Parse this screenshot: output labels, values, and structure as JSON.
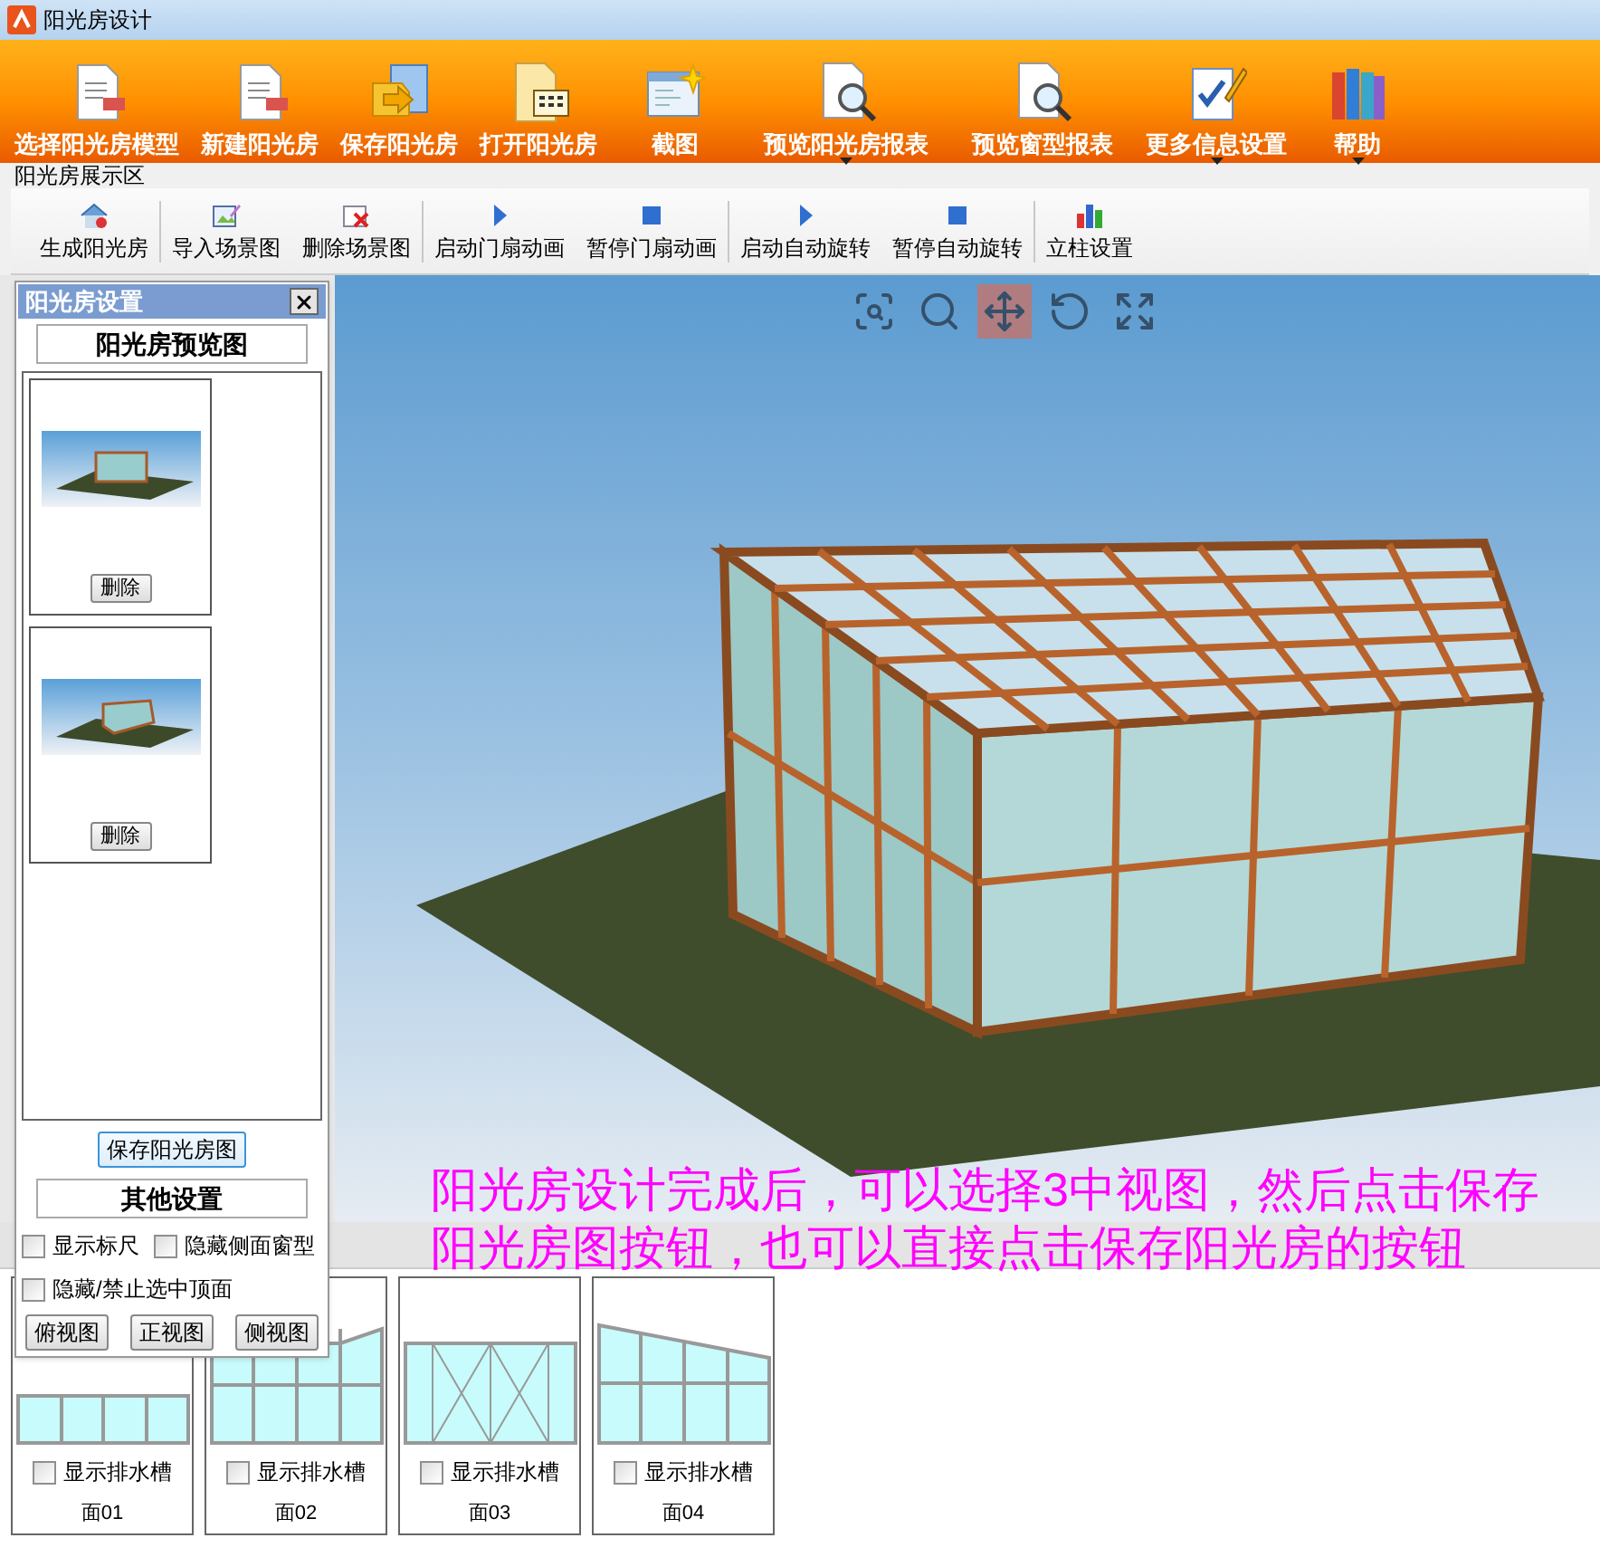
{
  "window": {
    "title": "阳光房设计"
  },
  "ribbon": [
    {
      "label": "选择阳光房模型",
      "kind": "document",
      "dropdown": false
    },
    {
      "label": "新建阳光房",
      "kind": "document",
      "dropdown": false
    },
    {
      "label": "保存阳光房",
      "kind": "save",
      "dropdown": false
    },
    {
      "label": "打开阳光房",
      "kind": "open",
      "dropdown": false
    },
    {
      "label": "截图",
      "kind": "capture",
      "dropdown": false
    },
    {
      "label": "预览阳光房报表",
      "kind": "report",
      "dropdown": true
    },
    {
      "label": "预览窗型报表",
      "kind": "report",
      "dropdown": false
    },
    {
      "label": "更多信息设置",
      "kind": "settings",
      "dropdown": true
    },
    {
      "label": "帮助",
      "kind": "help",
      "dropdown": true
    }
  ],
  "group_label": "阳光房展示区",
  "toolbar": [
    [
      {
        "label": "生成阳光房",
        "kind": "house"
      }
    ],
    [
      {
        "label": "导入场景图",
        "kind": "import"
      },
      {
        "label": "删除场景图",
        "kind": "delete"
      }
    ],
    [
      {
        "label": "启动门扇动画",
        "kind": "play"
      },
      {
        "label": "暂停门扇动画",
        "kind": "stop"
      }
    ],
    [
      {
        "label": "启动自动旋转",
        "kind": "play"
      },
      {
        "label": "暂停自动旋转",
        "kind": "stop"
      }
    ],
    [
      {
        "label": "立柱设置",
        "kind": "chart"
      }
    ]
  ],
  "view_tools": [
    {
      "kind": "zoom-window",
      "selected": false
    },
    {
      "kind": "zoom",
      "selected": false
    },
    {
      "kind": "pan",
      "selected": true
    },
    {
      "kind": "rotate",
      "selected": false
    },
    {
      "kind": "fit",
      "selected": false
    }
  ],
  "settings_panel": {
    "title": "阳光房设置",
    "preview_heading": "阳光房预览图",
    "previews": [
      {
        "kind": "front",
        "button": "删除"
      },
      {
        "kind": "angled",
        "button": "删除"
      }
    ],
    "save_button": "保存阳光房图",
    "other_heading": "其他设置",
    "options": [
      {
        "label": "显示标尺",
        "checked": false
      },
      {
        "label": "隐藏侧面窗型",
        "checked": false
      },
      {
        "label": "隐藏/禁止选中顶面",
        "checked": false
      }
    ],
    "view_buttons": [
      "俯视图",
      "正视图",
      "侧视图"
    ]
  },
  "annotation": "阳光房设计完成后，可以选择3中视图，然后点击保存阳光房图按钮，也可以直接点击保存阳光房的按钮",
  "faces": [
    {
      "label": "面01",
      "kind": "top",
      "option": "显示排水槽",
      "checked": false
    },
    {
      "label": "面02",
      "kind": "front",
      "option": "显示排水槽",
      "checked": false
    },
    {
      "label": "面03",
      "kind": "door",
      "option": "显示排水槽",
      "checked": false
    },
    {
      "label": "面04",
      "kind": "slope",
      "option": "显示排水槽",
      "checked": false
    }
  ]
}
